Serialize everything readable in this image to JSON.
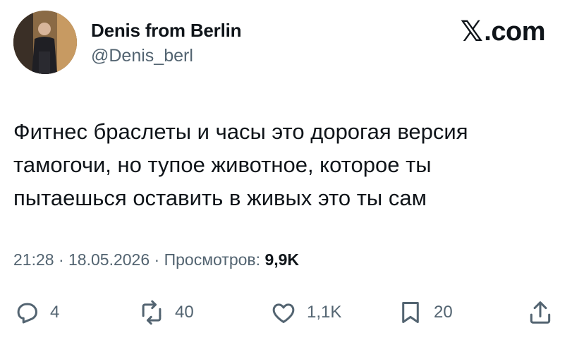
{
  "author": {
    "display_name": "Denis from Berlin",
    "handle": "@Denis_berl"
  },
  "brand": {
    "site": ".com",
    "logo_icon": "x-logo-icon"
  },
  "tweet": {
    "lines": [
      "Фитнес браслеты и часы это дорогая версия",
      "тамогочи, но тупое животное, которое ты",
      "пытаешься оставить в живых это ты сам"
    ]
  },
  "meta": {
    "time": "21:28",
    "date": "18.05.2026",
    "views_label": "Просмотров:",
    "views_count": "9,9K",
    "separator": "·"
  },
  "actions": {
    "replies": "4",
    "reposts": "40",
    "likes": "1,1K",
    "bookmarks": "20"
  },
  "colors": {
    "text": "#0f1419",
    "secondary": "#536471",
    "background": "#ffffff"
  }
}
